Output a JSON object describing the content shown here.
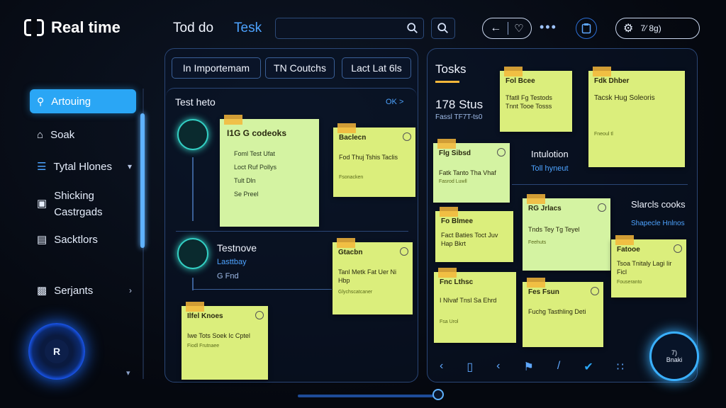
{
  "app": {
    "title": "Real time"
  },
  "nav": {
    "todo": "Tod do",
    "task": "Tesk"
  },
  "search": {
    "placeholder": ""
  },
  "status_pill": {
    "text": "7⁄ 8g)"
  },
  "sidebar": {
    "items": [
      {
        "label": "Artouing",
        "icon": "search-doc-icon"
      },
      {
        "label": "Soak",
        "icon": "home-icon"
      },
      {
        "label": "Tytal Hlones",
        "icon": "list-icon"
      },
      {
        "label": "Shicking Castrgads",
        "icon": "gallery-icon"
      },
      {
        "label": "Sacktlors",
        "icon": "document-icon"
      },
      {
        "label": "Serjants",
        "icon": "image-icon"
      }
    ],
    "knob_label": "R"
  },
  "left_panel": {
    "tabs": [
      "In Importemam",
      "TN Coutchs",
      "Lact Lat 6ls"
    ],
    "section_title": "Test heto",
    "section_action": "OK >",
    "group1": {
      "note_title": "I1G G codeoks",
      "items": [
        "Foml Test Ufat",
        "Loct Ruf Pollys",
        "Tult Dln",
        "Se Preel"
      ]
    },
    "group2": {
      "title": "Testnove",
      "sub1": "Lasttbay",
      "sub2": "G Fnd"
    },
    "note_a": {
      "title": "Baclecn",
      "text": "Fod Thuj Tshis Taclis",
      "sub": "Fsonacken"
    },
    "note_b": {
      "title": "Gtacbn",
      "text": "Tanl Metk Fat Uer Ni Hbp",
      "sub": "Glychscatcaner"
    },
    "note_c": {
      "title": "Ilfel Knoes",
      "text": "Iwe Tots Soek Ic Cptel",
      "sub": "Fiodl Frutnaee"
    }
  },
  "right_panel": {
    "title": "Tosks",
    "count_title": "178 Stus",
    "count_sub": "Fassl TF7T-ts0",
    "info_title": "Intulotion",
    "info_sub": "Toll hyneut",
    "side_title": "Slarcls cooks",
    "side_sub": "Shapecle Hnlnos",
    "notes": [
      {
        "title": "Fol Bcee",
        "text": "Tfatll Fg Testods Tnnt Tooe Tosss",
        "sub": ""
      },
      {
        "title": "Fdk Dhber",
        "text": "Tacsk Hug Soleoris",
        "sub": "Fneoul tl"
      },
      {
        "title": "Flg Sibsd",
        "text": "Fatk Tanto Tha Vhaf",
        "sub": "Fasrod Luwll"
      },
      {
        "title": "Fo Blmee",
        "text": "Fact Baties Toct Juv Hap Bkrt",
        "sub": ""
      },
      {
        "title": "RG Jrlacs",
        "text": "Tnds Tey Tg Teyel",
        "sub": "Feehuts"
      },
      {
        "title": "Fatooe",
        "text": "Tsoa Tnitaly Lagi Iir Ficl",
        "sub": "Fouseranto"
      },
      {
        "title": "Fnc Lthsc",
        "text": "I NIvaf Tnsl Sa Ehrd",
        "sub": "Fsa Urol"
      },
      {
        "title": "Fes Fsun",
        "text": "Fuchg Tasthling Deti",
        "sub": ""
      }
    ],
    "knob_top": "7)",
    "knob_bottom": "Bnaki"
  },
  "colors": {
    "accent": "#2aa6f5",
    "note": "#dbee7c",
    "tape": "#f4b63a",
    "teal": "#33d0c4"
  }
}
